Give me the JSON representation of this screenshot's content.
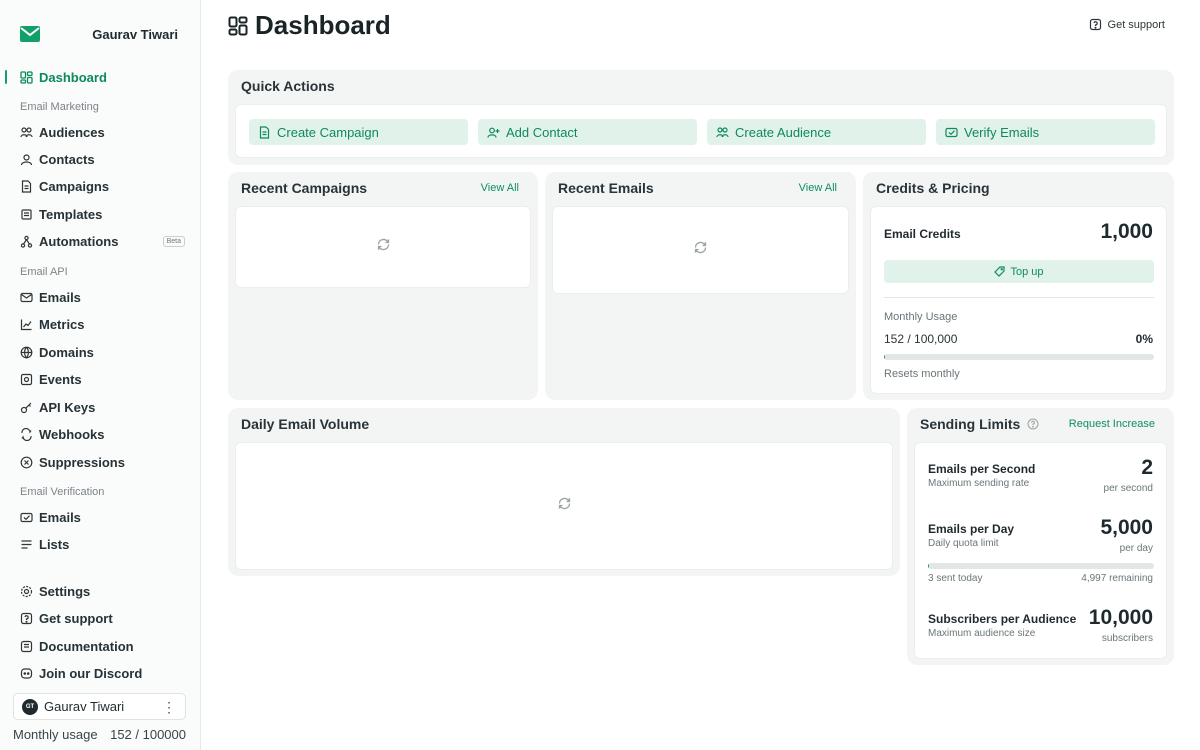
{
  "sidebar": {
    "user_name": "Gaurav Tiwari",
    "items_top": [
      {
        "label": "Dashboard"
      }
    ],
    "sections": [
      {
        "title": "Email Marketing",
        "items": [
          {
            "label": "Audiences"
          },
          {
            "label": "Contacts"
          },
          {
            "label": "Campaigns"
          },
          {
            "label": "Templates"
          },
          {
            "label": "Automations",
            "badge": "Beta"
          }
        ]
      },
      {
        "title": "Email API",
        "items": [
          {
            "label": "Emails"
          },
          {
            "label": "Metrics"
          },
          {
            "label": "Domains"
          },
          {
            "label": "Events"
          },
          {
            "label": "API Keys"
          },
          {
            "label": "Webhooks"
          },
          {
            "label": "Suppressions"
          }
        ]
      },
      {
        "title": "Email Verification",
        "items": [
          {
            "label": "Emails"
          },
          {
            "label": "Lists"
          }
        ]
      }
    ],
    "bottom_items": [
      {
        "label": "Settings"
      },
      {
        "label": "Get support"
      },
      {
        "label": "Documentation"
      },
      {
        "label": "Join our Discord"
      }
    ],
    "user_chip": {
      "initials": "GT",
      "name": "Gaurav Tiwari"
    },
    "usage": {
      "label": "Monthly usage",
      "value": "152 / 100000"
    }
  },
  "header": {
    "title": "Dashboard",
    "support_label": "Get support"
  },
  "quick_actions": {
    "title": "Quick Actions",
    "buttons": [
      {
        "label": "Create Campaign",
        "icon": "document-icon"
      },
      {
        "label": "Add Contact",
        "icon": "user-add-icon"
      },
      {
        "label": "Create Audience",
        "icon": "users-icon"
      },
      {
        "label": "Verify Emails",
        "icon": "mail-check-icon"
      }
    ]
  },
  "recent_campaigns": {
    "title": "Recent Campaigns",
    "link": "View All"
  },
  "recent_emails": {
    "title": "Recent Emails",
    "link": "View All"
  },
  "credits": {
    "title": "Credits & Pricing",
    "email_credits_label": "Email Credits",
    "email_credits_value": "1,000",
    "topup_label": "Top up",
    "monthly_usage_label": "Monthly Usage",
    "monthly_usage_value": "152 / 100,000",
    "monthly_usage_percent": "0%",
    "monthly_usage_fraction": 0.00152,
    "resets_label": "Resets monthly"
  },
  "daily_volume": {
    "title": "Daily Email Volume"
  },
  "sending_limits": {
    "title": "Sending Limits",
    "link": "Request Increase",
    "per_second": {
      "label": "Emails per Second",
      "sub": "Maximum sending rate",
      "value": "2",
      "unit": "per second"
    },
    "per_day": {
      "label": "Emails per Day",
      "sub": "Daily quota limit",
      "value": "5,000",
      "unit": "per day",
      "sent": "3 sent today",
      "remaining": "4,997 remaining",
      "fraction": 0.0006
    },
    "per_audience": {
      "label": "Subscribers per Audience",
      "sub": "Maximum audience size",
      "value": "10,000",
      "unit": "subscribers"
    }
  },
  "colors": {
    "accent": "#12a06a",
    "accent_text": "#0e8a5c",
    "button_bg": "#e1f2eb"
  }
}
